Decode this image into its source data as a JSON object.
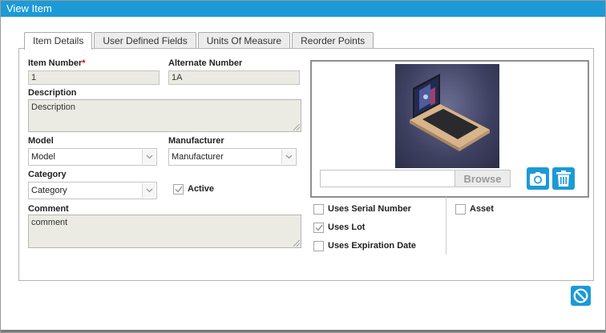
{
  "window": {
    "title": "View Item"
  },
  "tabs": [
    {
      "label": "Item Details",
      "active": true
    },
    {
      "label": "User Defined Fields",
      "active": false
    },
    {
      "label": "Units Of Measure",
      "active": false
    },
    {
      "label": "Reorder Points",
      "active": false
    }
  ],
  "form": {
    "item_number": {
      "label": "Item Number",
      "required_mark": "*",
      "value": "1"
    },
    "alternate_number": {
      "label": "Alternate Number",
      "value": "1A"
    },
    "description": {
      "label": "Description",
      "value": "Description"
    },
    "model": {
      "label": "Model",
      "value": "Model"
    },
    "manufacturer": {
      "label": "Manufacturer",
      "value": "Manufacturer"
    },
    "category": {
      "label": "Category",
      "value": "Category"
    },
    "active": {
      "label": "Active",
      "checked": true
    },
    "comment": {
      "label": "Comment",
      "value": "comment"
    }
  },
  "image_panel": {
    "browse_label": "Browse",
    "file_value": "",
    "camera_icon": "camera-icon",
    "delete_icon": "trash-icon"
  },
  "options": {
    "uses_serial_number": {
      "label": "Uses Serial Number",
      "checked": false
    },
    "uses_lot": {
      "label": "Uses Lot",
      "checked": true
    },
    "uses_expiration_date": {
      "label": "Uses Expiration Date",
      "checked": false
    },
    "asset": {
      "label": "Asset",
      "checked": false
    }
  },
  "colors": {
    "accent": "#1c9ad6",
    "field_bg": "#ebebe4"
  }
}
